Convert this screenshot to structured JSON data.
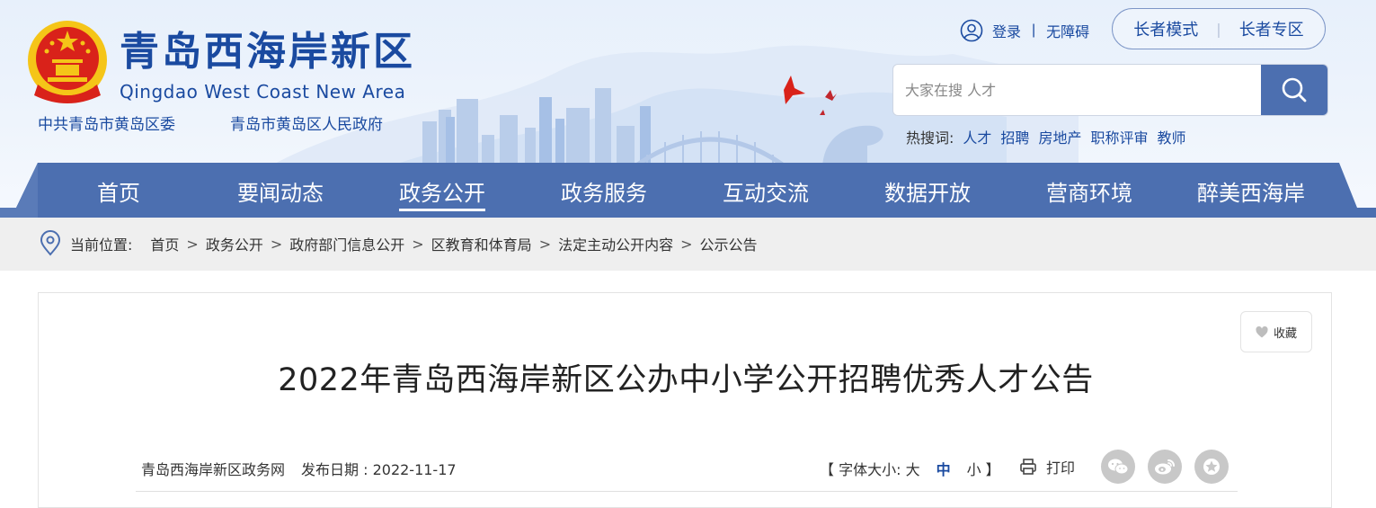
{
  "site": {
    "title": "青岛西海岸新区",
    "subtitle": "Qingdao West Coast New Area",
    "org_party": "中共青岛市黄岛区委",
    "org_gov": "青岛市黄岛区人民政府"
  },
  "top_links": {
    "login": "登录",
    "accessibility": "无障碍",
    "elder_mode": "长者模式",
    "elder_zone": "长者专区"
  },
  "search": {
    "placeholder": "大家在搜 人才",
    "hot_label": "热搜词:",
    "hot_words": [
      "人才",
      "招聘",
      "房地产",
      "职称评审",
      "教师"
    ]
  },
  "nav": {
    "items": [
      "首页",
      "要闻动态",
      "政务公开",
      "政务服务",
      "互动交流",
      "数据开放",
      "营商环境",
      "醉美西海岸"
    ],
    "active": "政务公开"
  },
  "breadcrumb": {
    "label": "当前位置:",
    "items": [
      "首页",
      "政务公开",
      "政府部门信息公开",
      "区教育和体育局",
      "法定主动公开内容",
      "公示公告"
    ]
  },
  "article": {
    "favorite": "收藏",
    "title": "2022年青岛西海岸新区公办中小学公开招聘优秀人才公告",
    "source": "青岛西海岸新区政务网",
    "date": "发布日期 : 2022-11-17",
    "font_size_label": "【 字体大小: 大",
    "font_mid": "中",
    "font_small": "小 】",
    "print": "打印"
  },
  "colors": {
    "brand_blue": "#1a4aa0",
    "nav_blue": "#4c6fb0",
    "crumb_bg": "#efefef",
    "share_gray": "#c8c8c8",
    "emblem_red": "#d9221a",
    "emblem_gold": "#f5c518"
  },
  "icons": {
    "user": "user-circle-icon",
    "search": "search-icon",
    "location": "map-pin-icon",
    "favorite": "heart-icon",
    "print": "printer-icon",
    "wechat": "wechat-icon",
    "weibo": "weibo-icon",
    "star": "star-icon"
  }
}
